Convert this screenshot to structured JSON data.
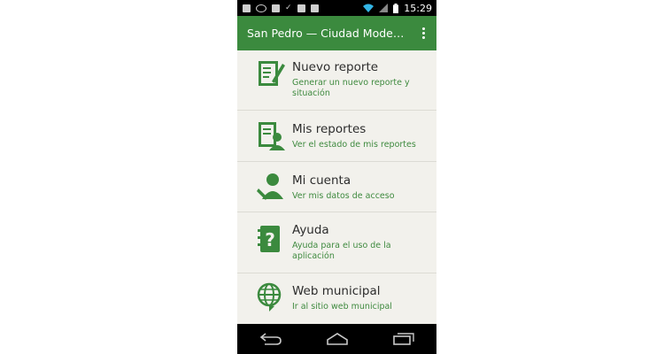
{
  "status_bar": {
    "time": "15:29",
    "icons": [
      "facebook-icon",
      "voicemail-icon",
      "image-icon",
      "check-icon",
      "camera-icon",
      "gallery-icon",
      "wifi-icon",
      "signal-icon",
      "battery-icon"
    ]
  },
  "app_bar": {
    "title": "San Pedro — Ciudad Moderna",
    "menu_icon": "overflow-menu-icon"
  },
  "menu": {
    "items": [
      {
        "title": "Nuevo reporte",
        "subtitle": "Generar un nuevo reporte y situación",
        "icon": "new-report-icon"
      },
      {
        "title": "Mis reportes",
        "subtitle": "Ver el estado de mis reportes",
        "icon": "my-reports-icon"
      },
      {
        "title": "Mi cuenta",
        "subtitle": "Ver mis datos de acceso",
        "icon": "account-icon"
      },
      {
        "title": "Ayuda",
        "subtitle": "Ayuda para el uso de la aplicación",
        "icon": "help-icon"
      },
      {
        "title": "Web municipal",
        "subtitle": "Ir al sitio web municipal",
        "icon": "globe-icon"
      }
    ]
  },
  "nav_bar": {
    "buttons": [
      "back-icon",
      "home-icon",
      "recents-icon"
    ]
  },
  "colors": {
    "primary": "#3b8a3e",
    "subtitle": "#3f8a3f",
    "background": "#f2f1ec"
  }
}
